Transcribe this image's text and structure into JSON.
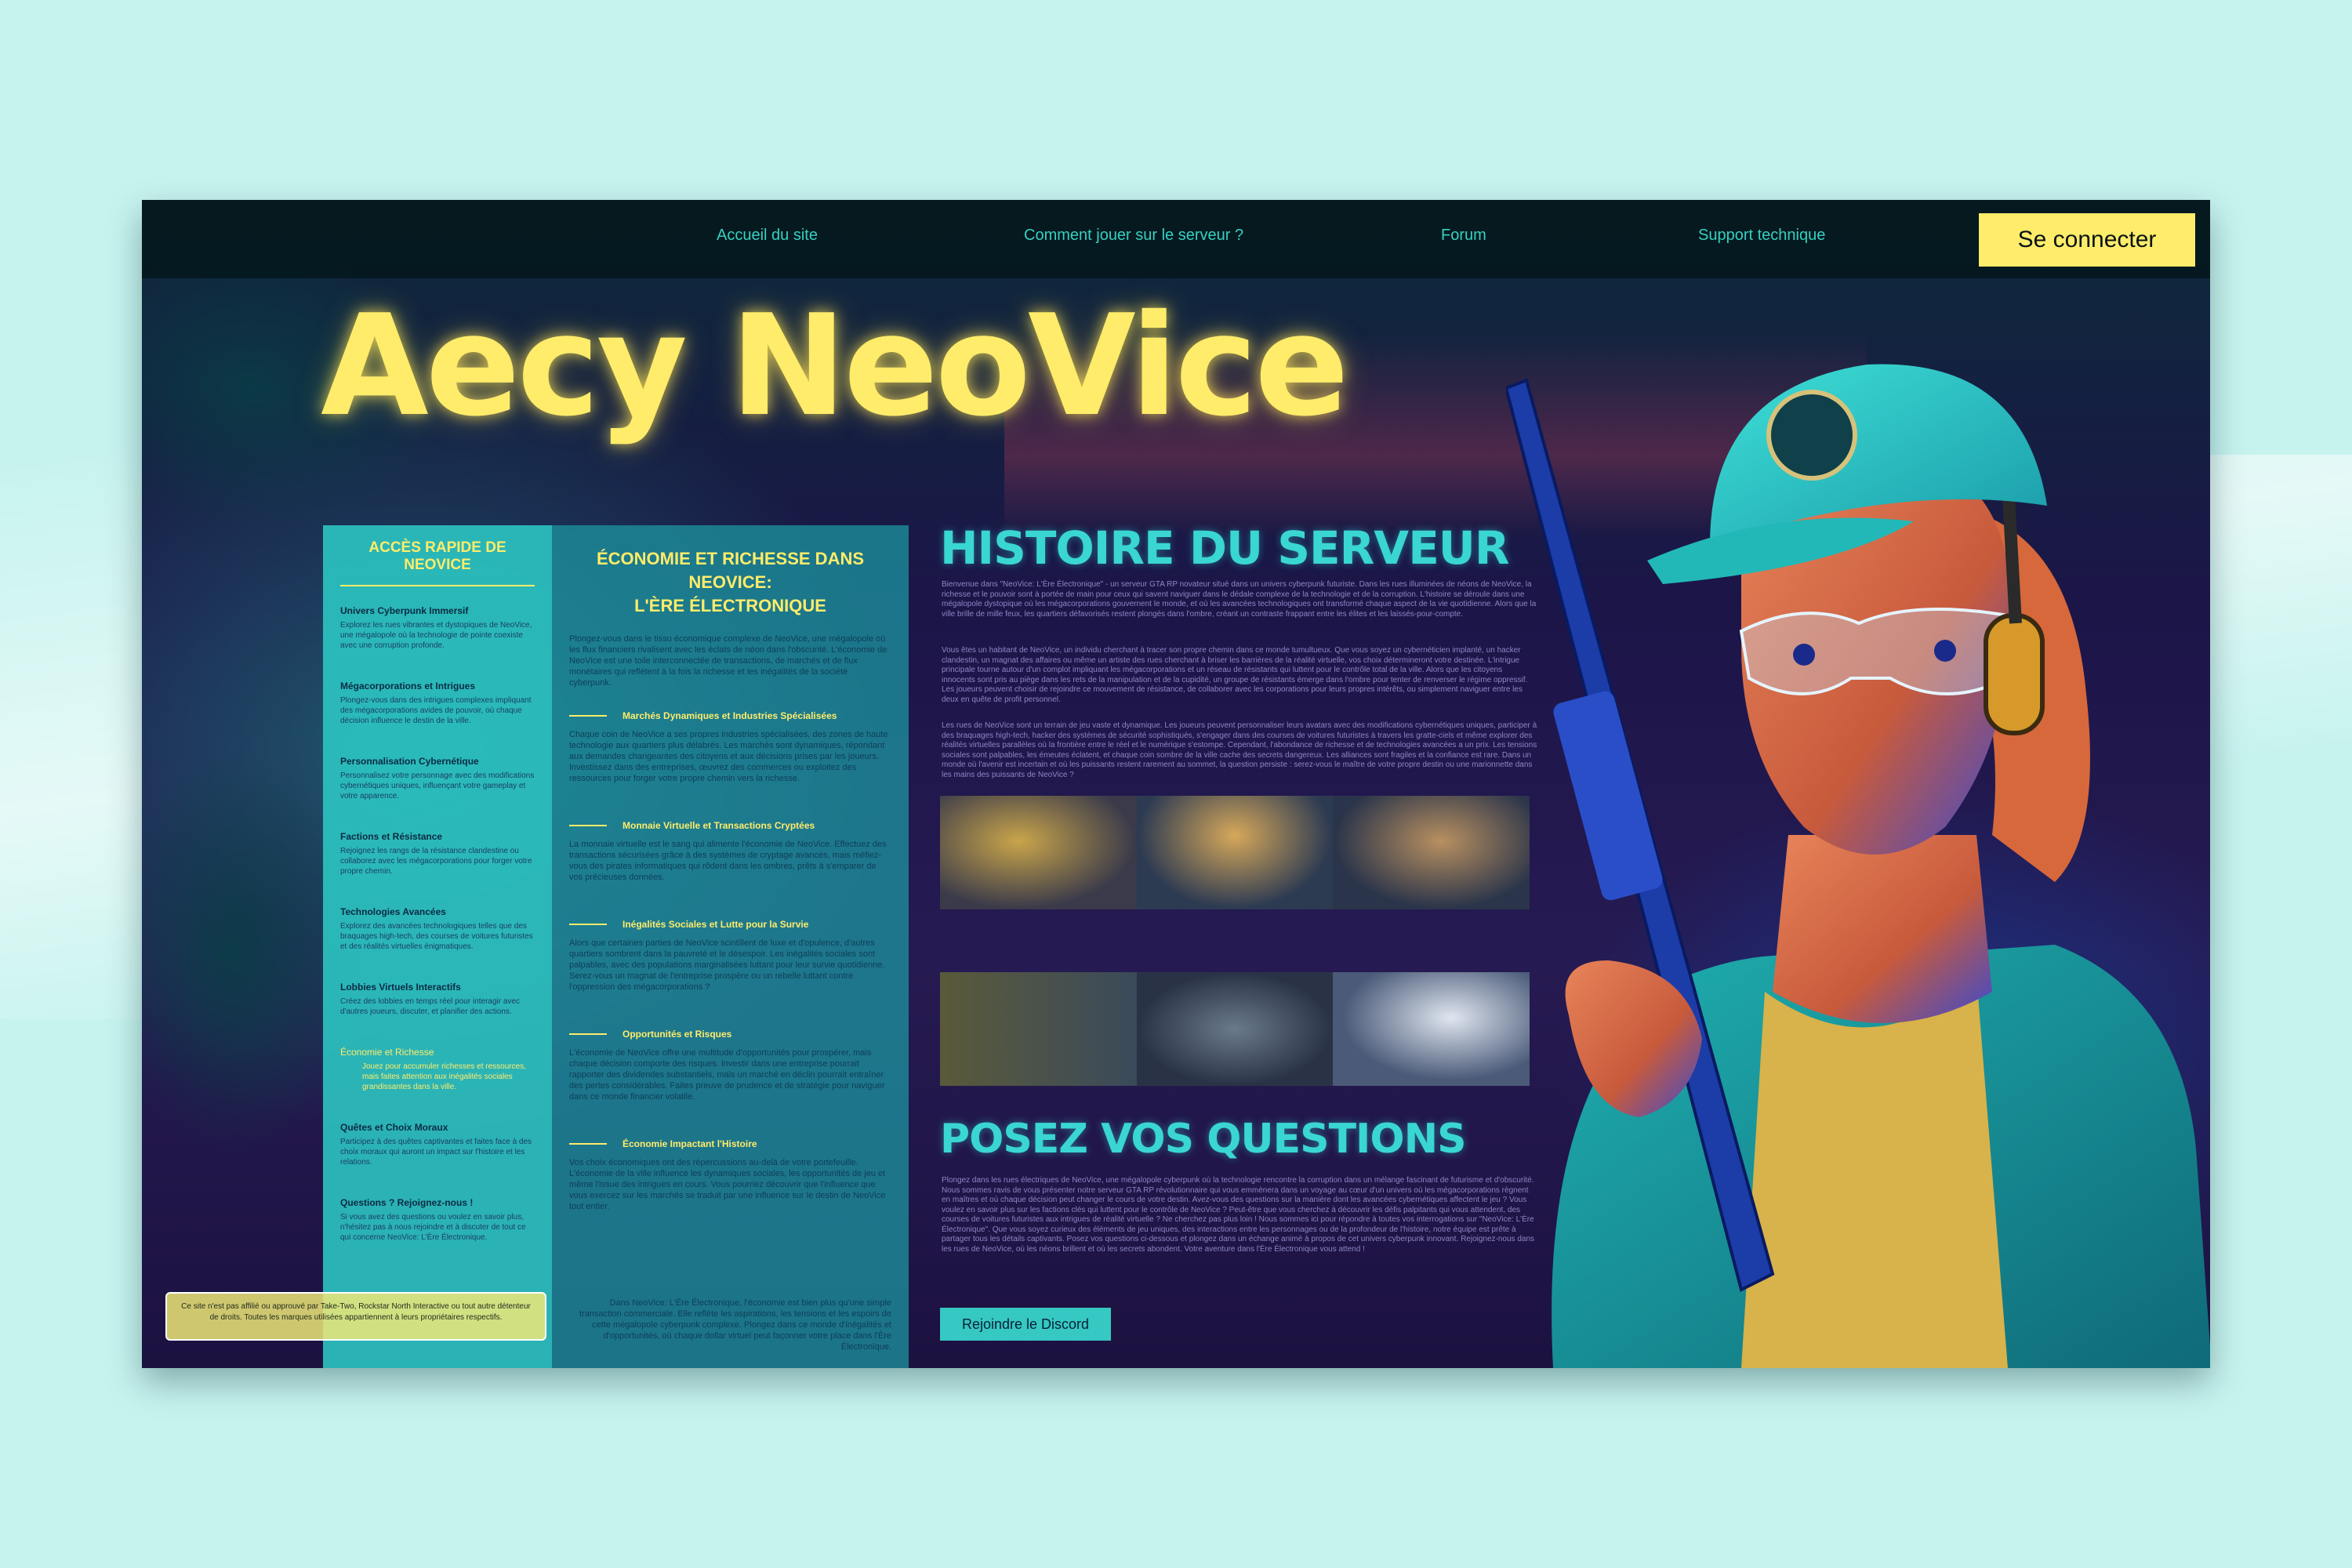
{
  "nav": {
    "links": [
      "Accueil du site",
      "Comment jouer sur le serveur ?",
      "Forum",
      "Support technique"
    ],
    "login": "Se connecter"
  },
  "brand": "Aecy NeoVice",
  "quick_access": {
    "title": "ACCÈS RAPIDE DE NEOVICE",
    "items": [
      {
        "title": "Univers Cyberpunk Immersif",
        "text": "Explorez les rues vibrantes et dystopiques de NeoVice, une mégalopole où la technologie de pointe coexiste avec une corruption profonde."
      },
      {
        "title": "Mégacorporations et Intrigues",
        "text": "Plongez-vous dans des intrigues complexes impliquant des mégacorporations avides de pouvoir, où chaque décision influence le destin de la ville."
      },
      {
        "title": "Personnalisation Cybernétique",
        "text": "Personnalisez votre personnage avec des modifications cybernétiques uniques, influençant votre gameplay et votre apparence."
      },
      {
        "title": "Factions et Résistance",
        "text": "Rejoignez les rangs de la résistance clandestine ou collaborez avec les mégacorporations pour forger votre propre chemin."
      },
      {
        "title": "Technologies Avancées",
        "text": "Explorez des avancées technologiques telles que des braquages high-tech, des courses de voitures futuristes et des réalités virtuelles énigmatiques."
      },
      {
        "title": "Lobbies Virtuels Interactifs",
        "text": "Créez des lobbies en temps réel pour interagir avec d'autres joueurs, discuter, et planifier des actions."
      },
      {
        "title": "Économie et Richesse",
        "text": "Jouez pour accumuler richesses et ressources, mais faites attention aux inégalités sociales grandissantes dans la ville."
      },
      {
        "title": "Quêtes et Choix Moraux",
        "text": "Participez à des quêtes captivantes et faites face à des choix moraux qui auront un impact sur l'histoire et les relations."
      },
      {
        "title": "Questions ? Rejoignez-nous !",
        "text": "Si vous avez des questions ou voulez en savoir plus, n'hésitez pas à nous rejoindre et à discuter de tout ce qui concerne NeoVice: L'Ère Électronique."
      }
    ],
    "active_index": 6
  },
  "disclaimer": "Ce site n'est pas affilié ou approuvé par Take-Two, Rockstar North Interactive ou tout autre détenteur de droits. Toutes les marques utilisées appartiennent à leurs propriétaires respectifs.",
  "economy": {
    "title_line1": "ÉCONOMIE ET RICHESSE DANS NEOVICE:",
    "title_line2": "L'ÈRE ÉLECTRONIQUE",
    "intro": "Plongez-vous dans le tissu économique complexe de NeoVice, une mégalopole où les flux financiers rivalisent avec les éclats de néon dans l'obscurité. L'économie de NeoVice est une toile interconnectée de transactions, de marchés et de flux monétaires qui reflètent à la fois la richesse et les inégalités de la société cyberpunk.",
    "sections": [
      {
        "title": "Marchés Dynamiques et Industries Spécialisées",
        "text": "Chaque coin de NeoVice a ses propres industries spécialisées, des zones de haute technologie aux quartiers plus délabrés. Les marchés sont dynamiques, répondant aux demandes changeantes des citoyens et aux décisions prises par les joueurs. Investissez dans des entreprises, œuvrez des commerces ou exploitez des ressources pour forger votre propre chemin vers la richesse."
      },
      {
        "title": "Monnaie Virtuelle et Transactions Cryptées",
        "text": "La monnaie virtuelle est le sang qui alimente l'économie de NeoVice. Effectuez des transactions sécurisées grâce à des systèmes de cryptage avancés, mais méfiez-vous des pirates informatiques qui rôdent dans les ombres, prêts à s'emparer de vos précieuses données."
      },
      {
        "title": "Inégalités Sociales et Lutte pour la Survie",
        "text": "Alors que certaines parties de NeoVice scintillent de luxe et d'opulence, d'autres quartiers sombrent dans la pauvreté et le désespoir. Les inégalités sociales sont palpables, avec des populations marginalisées luttant pour leur survie quotidienne. Serez-vous un magnat de l'entreprise prospère ou un rebelle luttant contre l'oppression des mégacorporations ?"
      },
      {
        "title": "Opportunités et Risques",
        "text": "L'économie de NeoVice offre une multitude d'opportunités pour prospérer, mais chaque décision comporte des risques. Investir dans une entreprise pourrait rapporter des dividendes substantiels, mais un marché en déclin pourrait entraîner des pertes considérables. Faites preuve de prudence et de stratégie pour naviguer dans ce monde financier volatile."
      },
      {
        "title": "Économie Impactant l'Histoire",
        "text": "Vos choix économiques ont des répercussions au-delà de votre portefeuille. L'économie de la ville influence les dynamiques sociales, les opportunités de jeu et même l'issue des intrigues en cours. Vous pourriez découvrir que l'influence que vous exercez sur les marchés se traduit par une influence sur le destin de NeoVice tout entier."
      }
    ],
    "outro": "Dans NeoVice: L'Ère Électronique, l'économie est bien plus qu'une simple transaction commerciale. Elle reflète les aspirations, les tensions et les espoirs de cette mégalopole cyberpunk complexe. Plongez dans ce monde d'inégalités et d'opportunités, où chaque dollar virtuel peut façonner votre place dans l'Ère Électronique."
  },
  "history": {
    "title": "HISTOIRE DU SERVEUR",
    "p1": "Bienvenue dans \"NeoVice: L'Ère Électronique\" - un serveur GTA RP novateur situé dans un univers cyberpunk futuriste. Dans les rues illuminées de néons de NeoVice, la richesse et le pouvoir sont à portée de main pour ceux qui savent naviguer dans le dédale complexe de la technologie et de la corruption. L'histoire se déroule dans une mégalopole dystopique où les mégacorporations gouvernent le monde, et où les avancées technologiques ont transformé chaque aspect de la vie quotidienne. Alors que la ville brille de mille feux, les quartiers défavorisés restent plongés dans l'ombre, créant un contraste frappant entre les élites et les laissés-pour-compte.",
    "p2": "Vous êtes un habitant de NeoVice, un individu cherchant à tracer son propre chemin dans ce monde tumultueux. Que vous soyez un cybernéticien implanté, un hacker clandestin, un magnat des affaires ou même un artiste des rues cherchant à briser les barrières de la réalité virtuelle, vos choix détermineront votre destinée. L'intrigue principale tourne autour d'un complot impliquant les mégacorporations et un réseau de résistants qui luttent pour le contrôle total de la ville. Alors que les citoyens innocents sont pris au piège dans les rets de la manipulation et de la cupidité, un groupe de résistants émerge dans l'ombre pour tenter de renverser le régime oppressif. Les joueurs peuvent choisir de rejoindre ce mouvement de résistance, de collaborer avec les corporations pour leurs propres intérêts, ou simplement naviguer entre les deux en quête de profit personnel.",
    "p3": "Les rues de NeoVice sont un terrain de jeu vaste et dynamique. Les joueurs peuvent personnaliser leurs avatars avec des modifications cybernétiques uniques, participer à des braquages high-tech, hacker des systèmes de sécurité sophistiqués, s'engager dans des courses de voitures futuristes à travers les gratte-ciels et même explorer des réalités virtuelles parallèles où la frontière entre le réel et le numérique s'estompe. Cependant, l'abondance de richesse et de technologies avancées a un prix. Les tensions sociales sont palpables, les émeutes éclatent, et chaque coin sombre de la ville cache des secrets dangereux. Les alliances sont fragiles et la confiance est rare. Dans un monde où l'avenir est incertain et où les puissants restent rarement au sommet, la question persiste : serez-vous le maître de votre propre destin ou une marionnette dans les mains des puissants de NeoVice ?"
  },
  "questions": {
    "title": "POSEZ VOS QUESTIONS",
    "text": "Plongez dans les rues électriques de NeoVice, une mégalopole cyberpunk où la technologie rencontre la corruption dans un mélange fascinant de futurisme et d'obscurité. Nous sommes ravis de vous présenter notre serveur GTA RP révolutionnaire qui vous emmènera dans un voyage au cœur d'un univers où les mégacorporations règnent en maîtres et où chaque décision peut changer le cours de votre destin. Avez-vous des questions sur la manière dont les avancées cybernétiques affectent le jeu ? Vous voulez en savoir plus sur les factions clés qui luttent pour le contrôle de NeoVice ? Peut-être que vous cherchez à découvrir les défis palpitants qui vous attendent, des courses de voitures futuristes aux intrigues de réalité virtuelle ? Ne cherchez pas plus loin ! Nous sommes ici pour répondre à toutes vos interrogations sur \"NeoVice: L'Ère Électronique\". Que vous soyez curieux des éléments de jeu uniques, des interactions entre les personnages ou de la profondeur de l'histoire, notre équipe est prête à partager tous les détails captivants. Posez vos questions ci-dessous et plongez dans un échange animé à propos de cet univers cyberpunk innovant. Rejoignez-nous dans les rues de NeoVice, où les néons brillent et où les secrets abondent. Votre aventure dans l'Ère Électronique vous attend !",
    "discord": "Rejoindre le Discord"
  },
  "colors": {
    "accent_yellow": "#ffec6a",
    "accent_teal": "#3ad6d2",
    "page_bg": "#c6f3ee"
  }
}
